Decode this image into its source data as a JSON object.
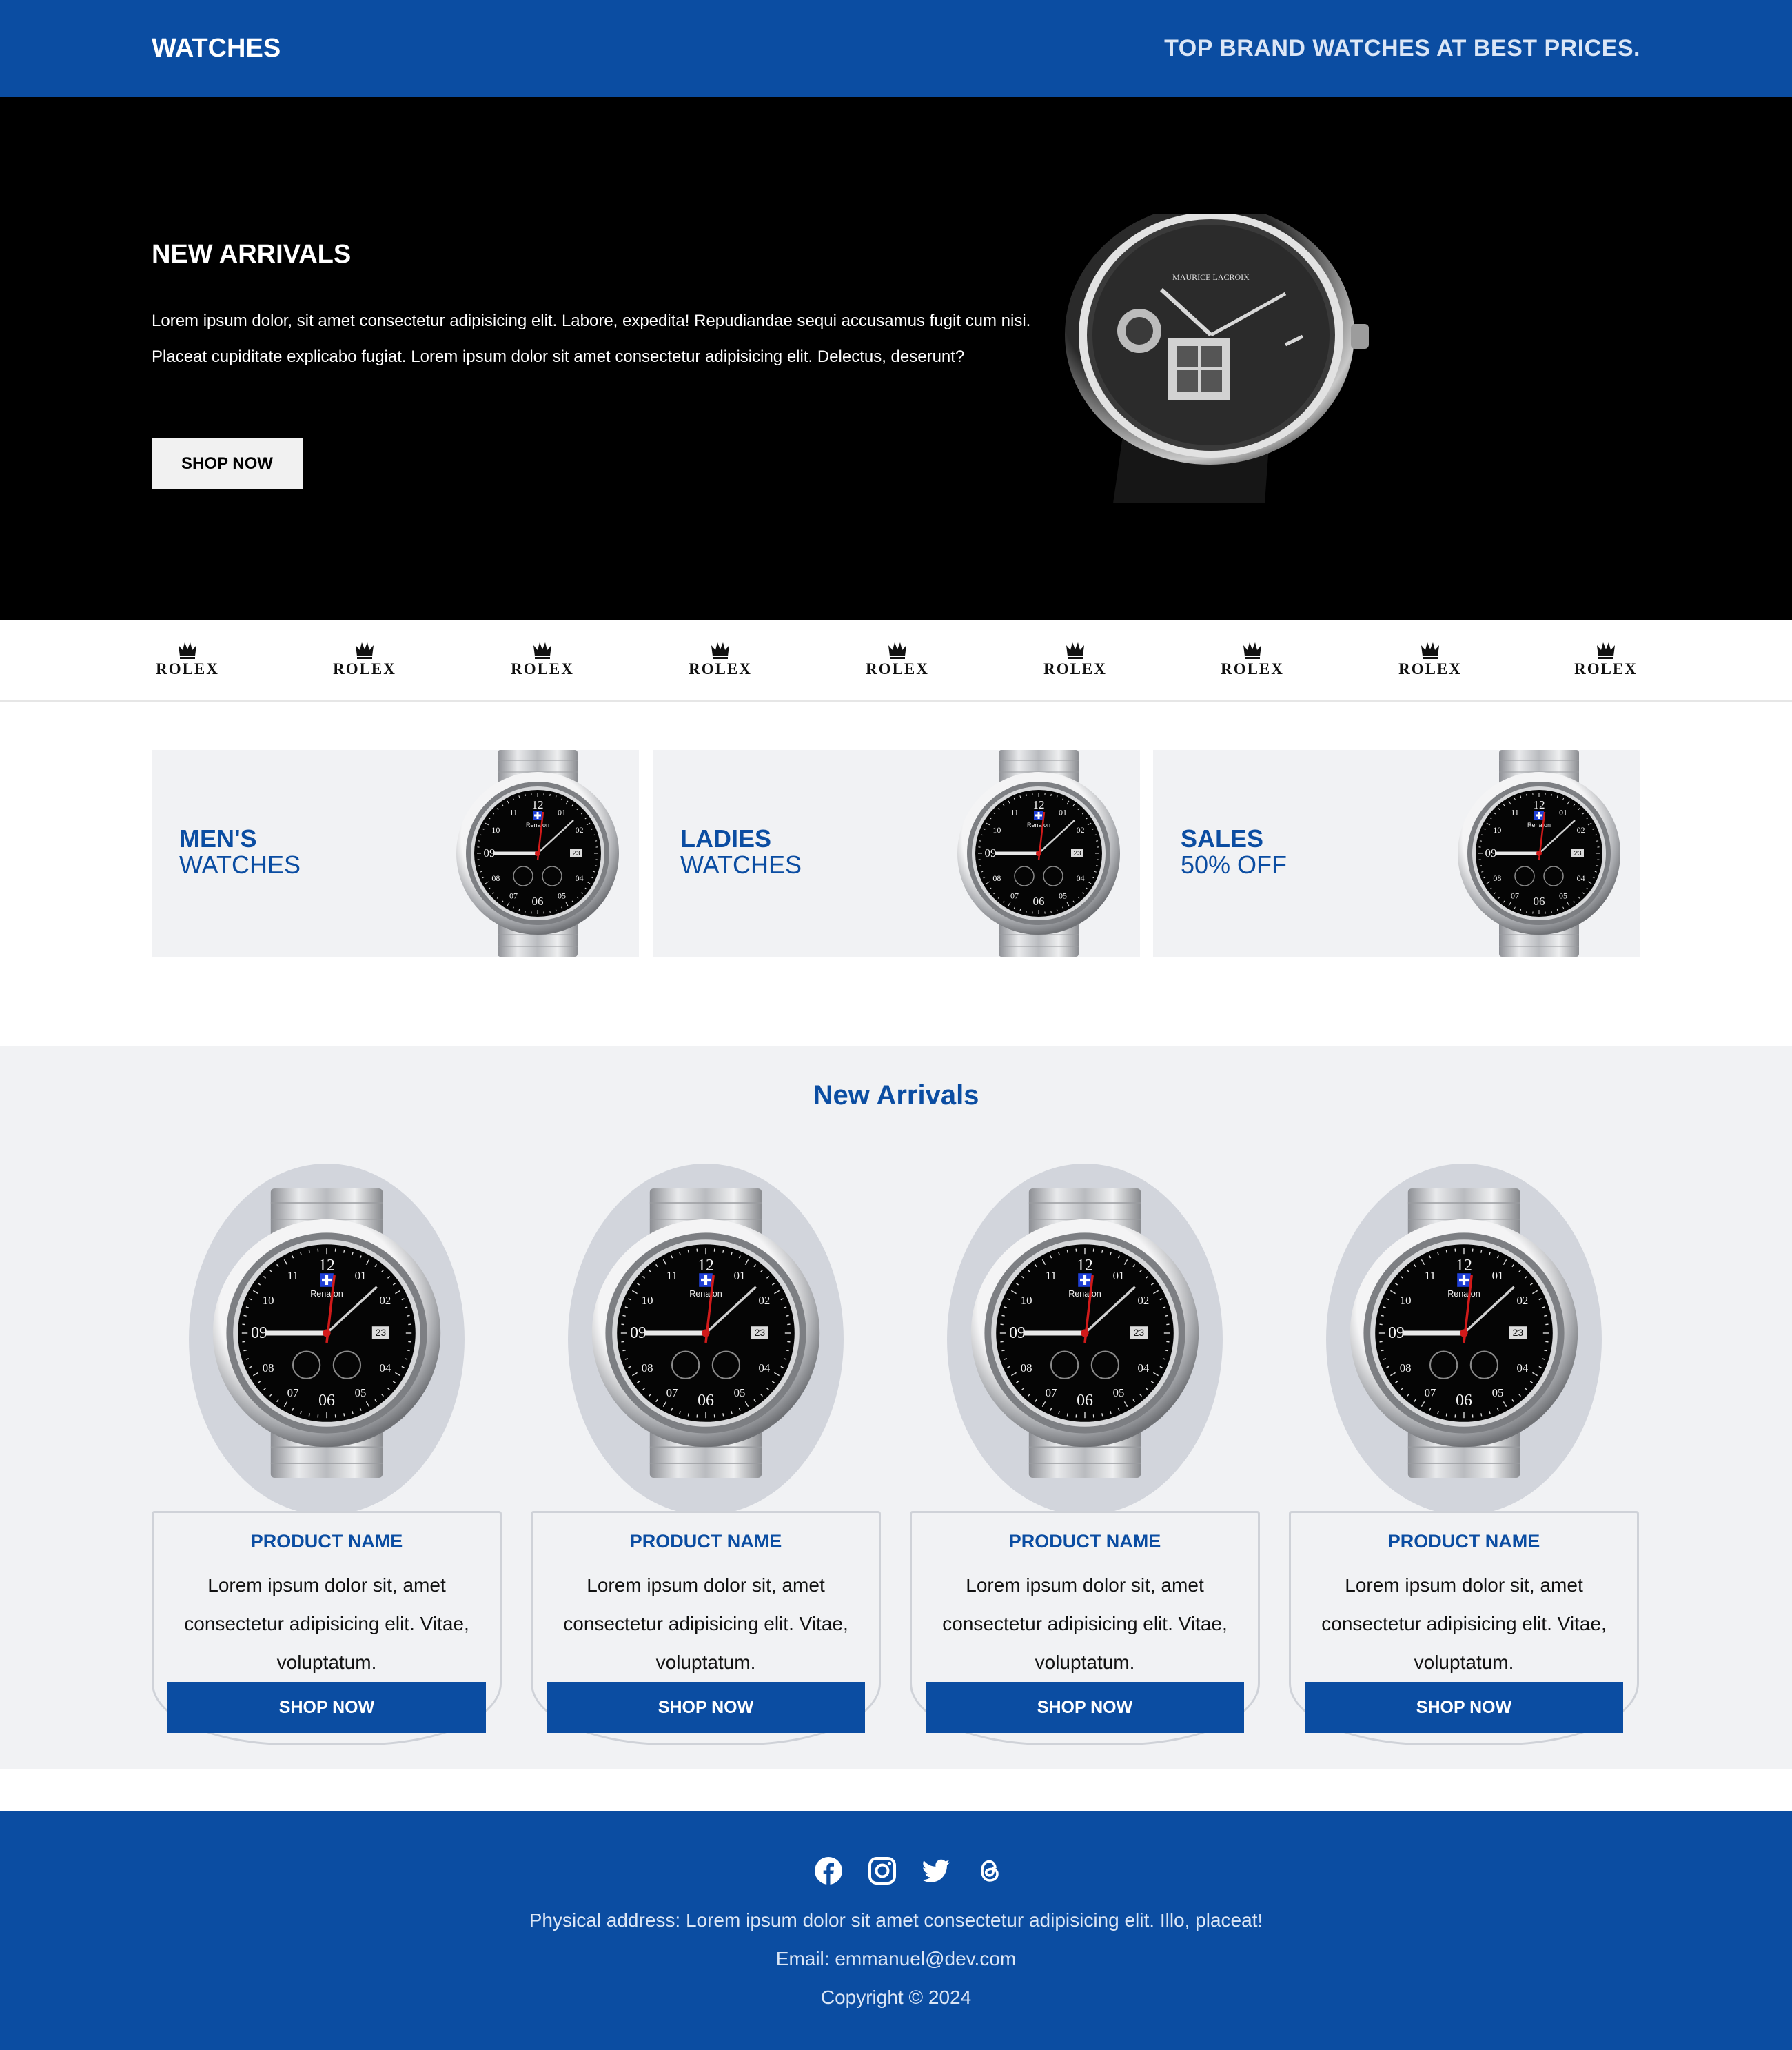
{
  "header": {
    "brand": "WATCHES",
    "tagline": "TOP BRAND WATCHES AT BEST PRICES."
  },
  "hero": {
    "title": "NEW ARRIVALS",
    "text": "Lorem ipsum dolor, sit amet consectetur adipisicing elit. Labore, expedita! Repudiandae sequi accusamus fugit cum nisi. Placeat cupiditate explicabo fugiat. Lorem ipsum dolor sit amet consectetur adipisicing elit. Delectus, deserunt?",
    "button": "SHOP NOW",
    "watch_brand": "MAURICE LACROIX"
  },
  "brands": [
    "ROLEX",
    "ROLEX",
    "ROLEX",
    "ROLEX",
    "ROLEX",
    "ROLEX",
    "ROLEX",
    "ROLEX",
    "ROLEX"
  ],
  "categories": [
    {
      "title": "MEN'S",
      "subtitle": "WATCHES"
    },
    {
      "title": "LADIES",
      "subtitle": "WATCHES"
    },
    {
      "title": "SALES",
      "subtitle": "50% OFF"
    }
  ],
  "watch_dial": {
    "brand": "Renaton",
    "date": "23",
    "numbers": [
      "12",
      "01",
      "02",
      "04",
      "05",
      "06",
      "07",
      "08",
      "09",
      "10",
      "11"
    ]
  },
  "arrivals": {
    "title": "New Arrivals",
    "products": [
      {
        "name": "PRODUCT NAME",
        "description": "Lorem ipsum dolor sit, amet consectetur adipisicing elit. Vitae, voluptatum.",
        "button": "SHOP NOW"
      },
      {
        "name": "PRODUCT NAME",
        "description": "Lorem ipsum dolor sit, amet consectetur adipisicing elit. Vitae, voluptatum.",
        "button": "SHOP NOW"
      },
      {
        "name": "PRODUCT NAME",
        "description": "Lorem ipsum dolor sit, amet consectetur adipisicing elit. Vitae, voluptatum.",
        "button": "SHOP NOW"
      },
      {
        "name": "PRODUCT NAME",
        "description": "Lorem ipsum dolor sit, amet consectetur adipisicing elit. Vitae, voluptatum.",
        "button": "SHOP NOW"
      }
    ]
  },
  "footer": {
    "socials": [
      "facebook-icon",
      "instagram-icon",
      "twitter-icon",
      "threads-icon"
    ],
    "address": "Physical address: Lorem ipsum dolor sit amet consectetur adipisicing elit. Illo, placeat!",
    "email": "Email: emmanuel@dev.com",
    "copyright": "Copyright © 2024"
  },
  "colors": {
    "primary": "#0b4da2",
    "hero_background": "#000000",
    "section_background": "#f1f2f4",
    "oval": "#d2d5dc"
  }
}
